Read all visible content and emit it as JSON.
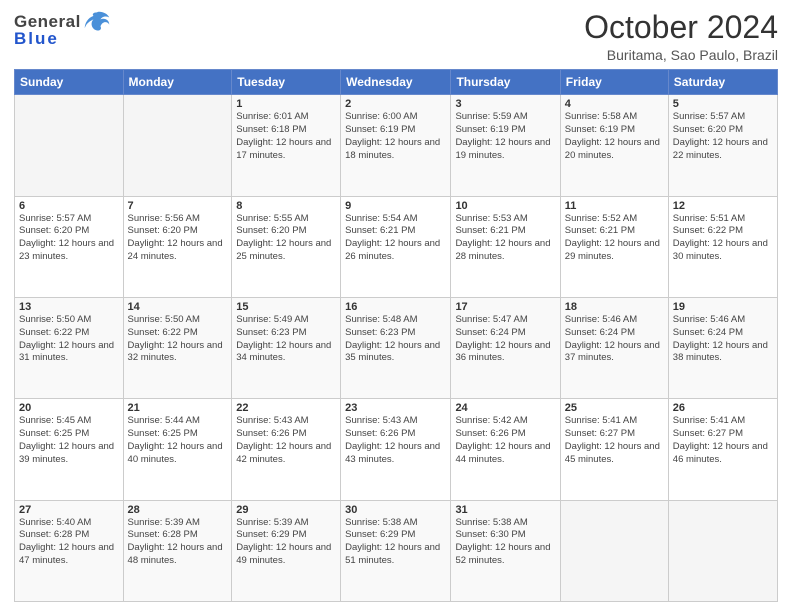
{
  "header": {
    "logo_general": "General",
    "logo_blue": "Blue",
    "month_year": "October 2024",
    "location": "Buritama, Sao Paulo, Brazil"
  },
  "days_of_week": [
    "Sunday",
    "Monday",
    "Tuesday",
    "Wednesday",
    "Thursday",
    "Friday",
    "Saturday"
  ],
  "weeks": [
    [
      {
        "day": "",
        "sunrise": "",
        "sunset": "",
        "daylight": ""
      },
      {
        "day": "",
        "sunrise": "",
        "sunset": "",
        "daylight": ""
      },
      {
        "day": "1",
        "sunrise": "Sunrise: 6:01 AM",
        "sunset": "Sunset: 6:18 PM",
        "daylight": "Daylight: 12 hours and 17 minutes."
      },
      {
        "day": "2",
        "sunrise": "Sunrise: 6:00 AM",
        "sunset": "Sunset: 6:19 PM",
        "daylight": "Daylight: 12 hours and 18 minutes."
      },
      {
        "day": "3",
        "sunrise": "Sunrise: 5:59 AM",
        "sunset": "Sunset: 6:19 PM",
        "daylight": "Daylight: 12 hours and 19 minutes."
      },
      {
        "day": "4",
        "sunrise": "Sunrise: 5:58 AM",
        "sunset": "Sunset: 6:19 PM",
        "daylight": "Daylight: 12 hours and 20 minutes."
      },
      {
        "day": "5",
        "sunrise": "Sunrise: 5:57 AM",
        "sunset": "Sunset: 6:20 PM",
        "daylight": "Daylight: 12 hours and 22 minutes."
      }
    ],
    [
      {
        "day": "6",
        "sunrise": "Sunrise: 5:57 AM",
        "sunset": "Sunset: 6:20 PM",
        "daylight": "Daylight: 12 hours and 23 minutes."
      },
      {
        "day": "7",
        "sunrise": "Sunrise: 5:56 AM",
        "sunset": "Sunset: 6:20 PM",
        "daylight": "Daylight: 12 hours and 24 minutes."
      },
      {
        "day": "8",
        "sunrise": "Sunrise: 5:55 AM",
        "sunset": "Sunset: 6:20 PM",
        "daylight": "Daylight: 12 hours and 25 minutes."
      },
      {
        "day": "9",
        "sunrise": "Sunrise: 5:54 AM",
        "sunset": "Sunset: 6:21 PM",
        "daylight": "Daylight: 12 hours and 26 minutes."
      },
      {
        "day": "10",
        "sunrise": "Sunrise: 5:53 AM",
        "sunset": "Sunset: 6:21 PM",
        "daylight": "Daylight: 12 hours and 28 minutes."
      },
      {
        "day": "11",
        "sunrise": "Sunrise: 5:52 AM",
        "sunset": "Sunset: 6:21 PM",
        "daylight": "Daylight: 12 hours and 29 minutes."
      },
      {
        "day": "12",
        "sunrise": "Sunrise: 5:51 AM",
        "sunset": "Sunset: 6:22 PM",
        "daylight": "Daylight: 12 hours and 30 minutes."
      }
    ],
    [
      {
        "day": "13",
        "sunrise": "Sunrise: 5:50 AM",
        "sunset": "Sunset: 6:22 PM",
        "daylight": "Daylight: 12 hours and 31 minutes."
      },
      {
        "day": "14",
        "sunrise": "Sunrise: 5:50 AM",
        "sunset": "Sunset: 6:22 PM",
        "daylight": "Daylight: 12 hours and 32 minutes."
      },
      {
        "day": "15",
        "sunrise": "Sunrise: 5:49 AM",
        "sunset": "Sunset: 6:23 PM",
        "daylight": "Daylight: 12 hours and 34 minutes."
      },
      {
        "day": "16",
        "sunrise": "Sunrise: 5:48 AM",
        "sunset": "Sunset: 6:23 PM",
        "daylight": "Daylight: 12 hours and 35 minutes."
      },
      {
        "day": "17",
        "sunrise": "Sunrise: 5:47 AM",
        "sunset": "Sunset: 6:24 PM",
        "daylight": "Daylight: 12 hours and 36 minutes."
      },
      {
        "day": "18",
        "sunrise": "Sunrise: 5:46 AM",
        "sunset": "Sunset: 6:24 PM",
        "daylight": "Daylight: 12 hours and 37 minutes."
      },
      {
        "day": "19",
        "sunrise": "Sunrise: 5:46 AM",
        "sunset": "Sunset: 6:24 PM",
        "daylight": "Daylight: 12 hours and 38 minutes."
      }
    ],
    [
      {
        "day": "20",
        "sunrise": "Sunrise: 5:45 AM",
        "sunset": "Sunset: 6:25 PM",
        "daylight": "Daylight: 12 hours and 39 minutes."
      },
      {
        "day": "21",
        "sunrise": "Sunrise: 5:44 AM",
        "sunset": "Sunset: 6:25 PM",
        "daylight": "Daylight: 12 hours and 40 minutes."
      },
      {
        "day": "22",
        "sunrise": "Sunrise: 5:43 AM",
        "sunset": "Sunset: 6:26 PM",
        "daylight": "Daylight: 12 hours and 42 minutes."
      },
      {
        "day": "23",
        "sunrise": "Sunrise: 5:43 AM",
        "sunset": "Sunset: 6:26 PM",
        "daylight": "Daylight: 12 hours and 43 minutes."
      },
      {
        "day": "24",
        "sunrise": "Sunrise: 5:42 AM",
        "sunset": "Sunset: 6:26 PM",
        "daylight": "Daylight: 12 hours and 44 minutes."
      },
      {
        "day": "25",
        "sunrise": "Sunrise: 5:41 AM",
        "sunset": "Sunset: 6:27 PM",
        "daylight": "Daylight: 12 hours and 45 minutes."
      },
      {
        "day": "26",
        "sunrise": "Sunrise: 5:41 AM",
        "sunset": "Sunset: 6:27 PM",
        "daylight": "Daylight: 12 hours and 46 minutes."
      }
    ],
    [
      {
        "day": "27",
        "sunrise": "Sunrise: 5:40 AM",
        "sunset": "Sunset: 6:28 PM",
        "daylight": "Daylight: 12 hours and 47 minutes."
      },
      {
        "day": "28",
        "sunrise": "Sunrise: 5:39 AM",
        "sunset": "Sunset: 6:28 PM",
        "daylight": "Daylight: 12 hours and 48 minutes."
      },
      {
        "day": "29",
        "sunrise": "Sunrise: 5:39 AM",
        "sunset": "Sunset: 6:29 PM",
        "daylight": "Daylight: 12 hours and 49 minutes."
      },
      {
        "day": "30",
        "sunrise": "Sunrise: 5:38 AM",
        "sunset": "Sunset: 6:29 PM",
        "daylight": "Daylight: 12 hours and 51 minutes."
      },
      {
        "day": "31",
        "sunrise": "Sunrise: 5:38 AM",
        "sunset": "Sunset: 6:30 PM",
        "daylight": "Daylight: 12 hours and 52 minutes."
      },
      {
        "day": "",
        "sunrise": "",
        "sunset": "",
        "daylight": ""
      },
      {
        "day": "",
        "sunrise": "",
        "sunset": "",
        "daylight": ""
      }
    ]
  ]
}
